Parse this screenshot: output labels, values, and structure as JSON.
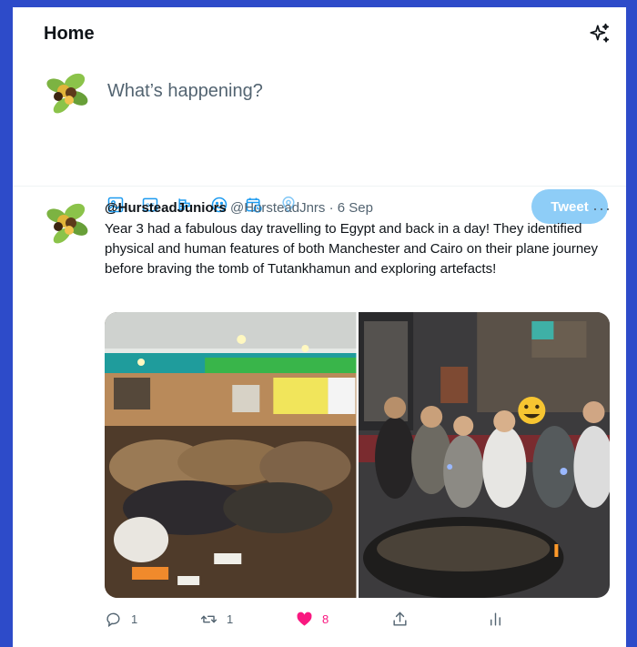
{
  "header": {
    "title": "Home",
    "sparkle_icon": "sparkle-icon"
  },
  "compose": {
    "placeholder": "What’s happening?",
    "tools": [
      "image-icon",
      "gif-icon",
      "poll-icon",
      "emoji-icon",
      "schedule-icon",
      "location-icon"
    ],
    "tweet_label": "Tweet"
  },
  "tweet": {
    "name": "@HursteadJuniors",
    "handle": "@HursteadJnrs",
    "separator": "·",
    "date": "6 Sep",
    "more": "···",
    "text": "Year 3 had a fabulous day travelling to Egypt and back in a day! They identified physical and human features of both Manchester and Cairo on their plane journey before braving the tomb of Tutankhamun and exploring artefacts!",
    "actions": {
      "replies": "1",
      "retweets": "1",
      "likes": "8"
    }
  },
  "colors": {
    "accent": "#1d9bf0",
    "tweet_button": "#8ecdf7",
    "like": "#f91880",
    "background": "#2d4bc9"
  }
}
